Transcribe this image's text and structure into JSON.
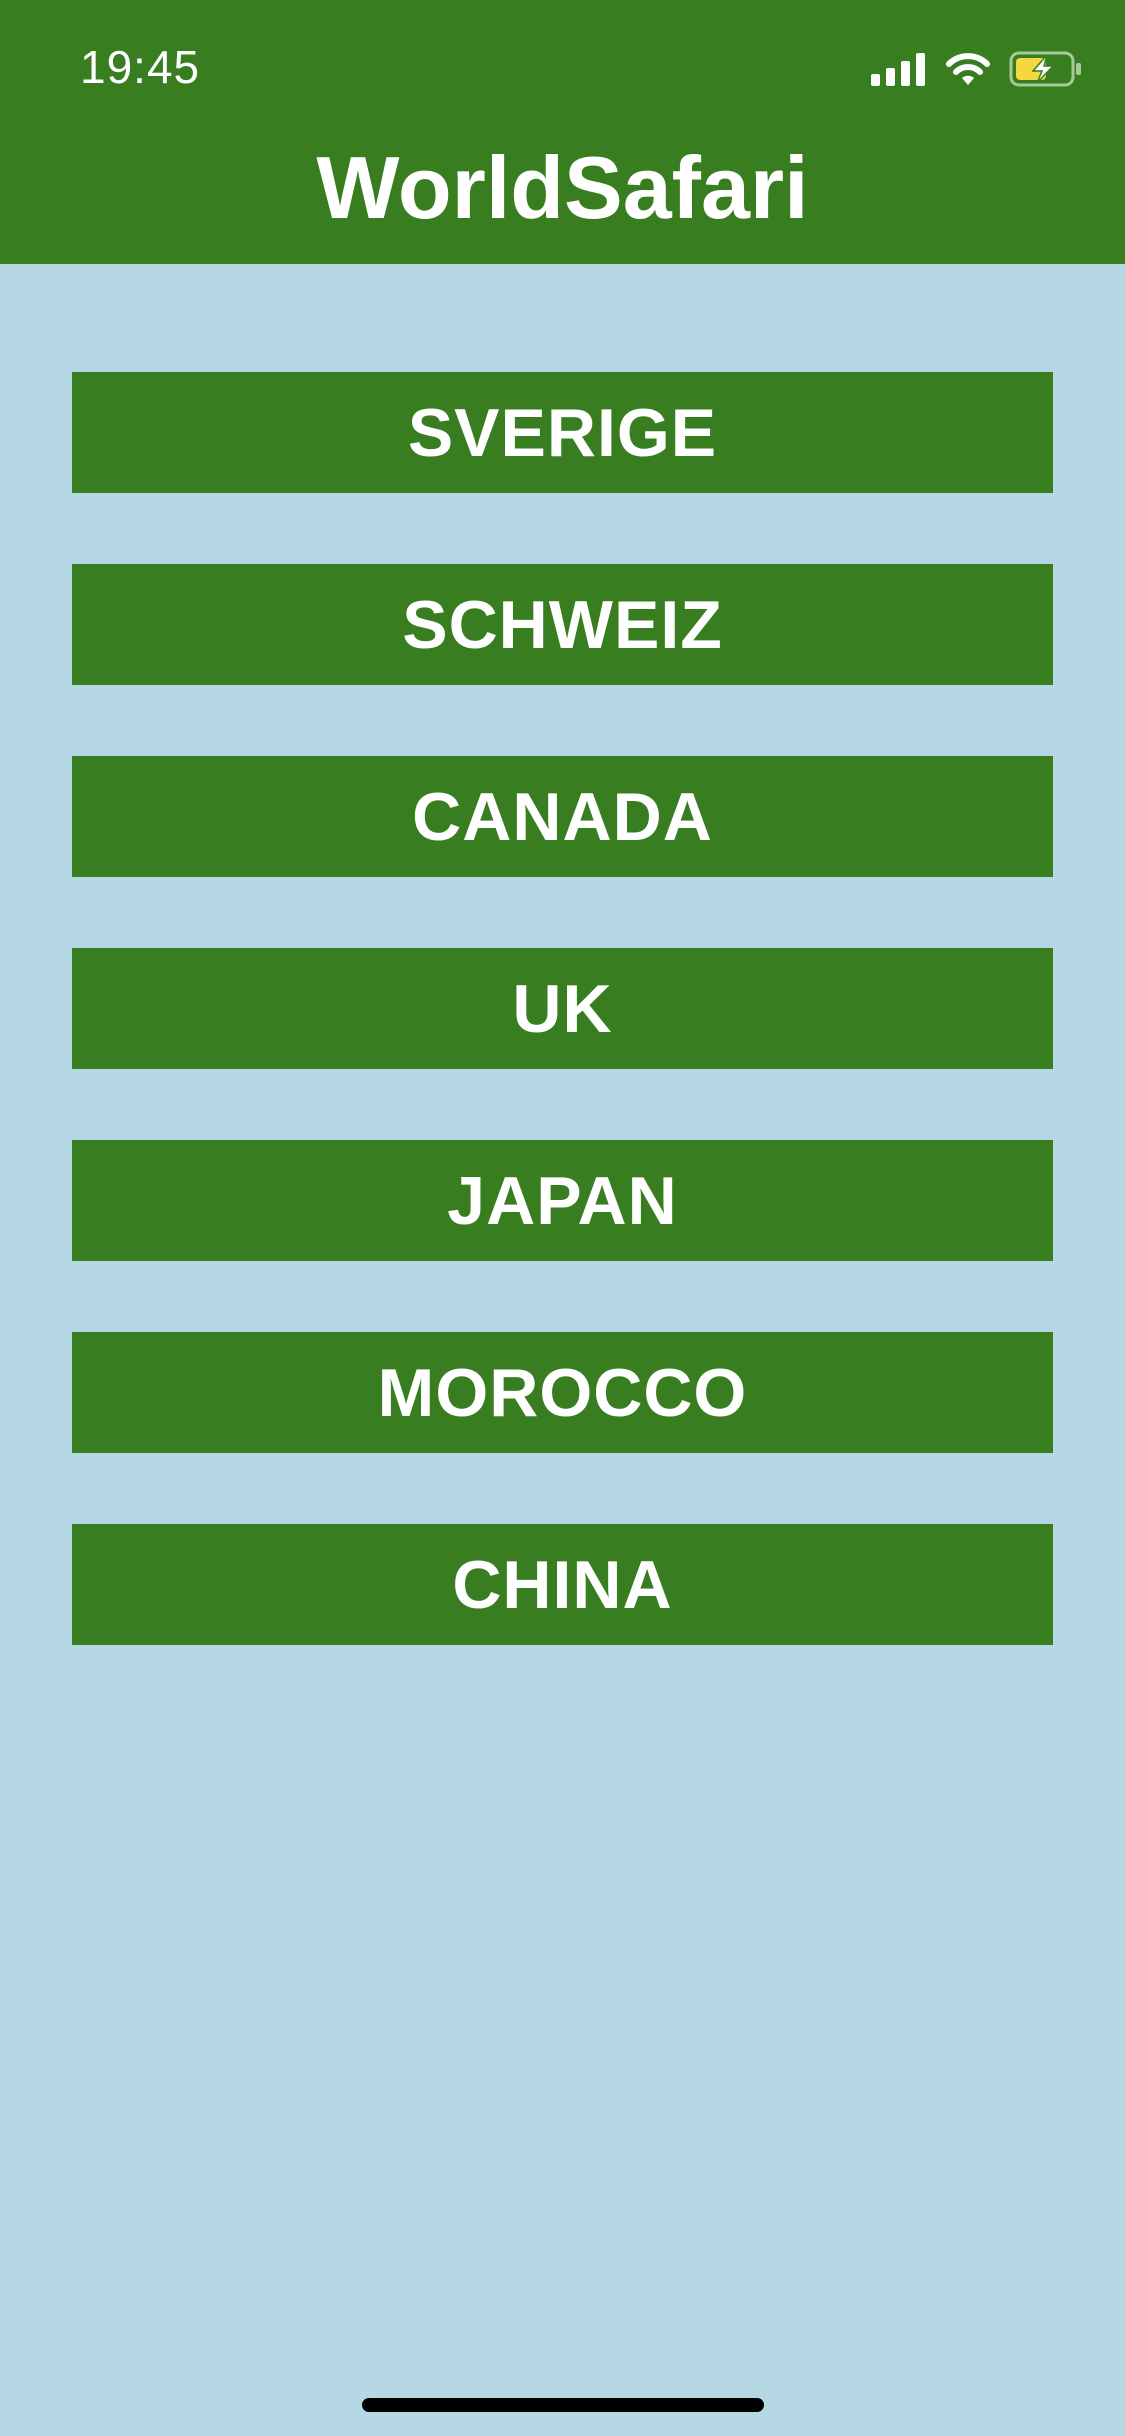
{
  "status_bar": {
    "time": "19:45",
    "icons": [
      "cellular-signal-icon",
      "wifi-icon",
      "battery-charging-icon"
    ],
    "battery_color": "#f5d742"
  },
  "header": {
    "title": "WorldSafari",
    "background": "#387e21"
  },
  "countries": [
    {
      "label": "SVERIGE"
    },
    {
      "label": "SCHWEIZ"
    },
    {
      "label": "CANADA"
    },
    {
      "label": "UK"
    },
    {
      "label": "JAPAN"
    },
    {
      "label": "MOROCCO"
    },
    {
      "label": "CHINA"
    }
  ],
  "colors": {
    "page_background": "#b5d8e4",
    "button_background": "#387e21",
    "text": "#ffffff"
  }
}
